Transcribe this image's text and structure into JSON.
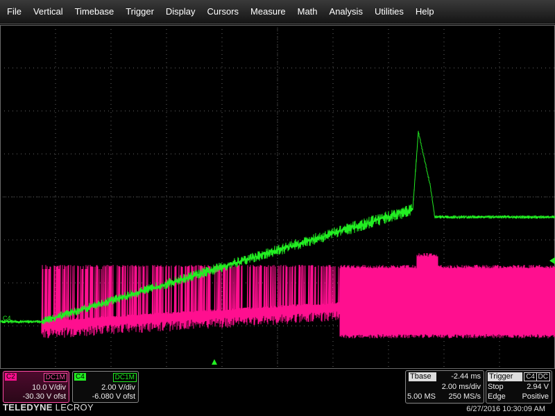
{
  "menu": [
    "File",
    "Vertical",
    "Timebase",
    "Trigger",
    "Display",
    "Cursors",
    "Measure",
    "Math",
    "Analysis",
    "Utilities",
    "Help"
  ],
  "markers": {
    "c4_left": "C4"
  },
  "colors": {
    "c2": "#ff0f8f",
    "c4": "#22ee22",
    "grid": "#6a6a6a"
  },
  "channels": {
    "c2": {
      "name": "C2",
      "coupling": "DC1M",
      "vdiv": "10.0 V/div",
      "offset": "-30.30 V ofst"
    },
    "c4": {
      "name": "C4",
      "coupling": "DC1M",
      "vdiv": "2.00 V/div",
      "offset": "-6.080 V ofst"
    }
  },
  "timebase": {
    "label": "Tbase",
    "delay": "-2.44 ms",
    "tdiv": "2.00 ms/div",
    "samples": "5.00 MS",
    "rate": "250 MS/s"
  },
  "trigger": {
    "label": "Trigger",
    "source": "C4",
    "coupling": "DC",
    "mode": "Stop",
    "level": "2.94 V",
    "type": "Edge",
    "slope": "Positive"
  },
  "footer": {
    "brand_bold": "TELEDYNE",
    "brand_rest": " LECROY",
    "datetime": "6/27/2016 10:30:09 AM"
  }
}
